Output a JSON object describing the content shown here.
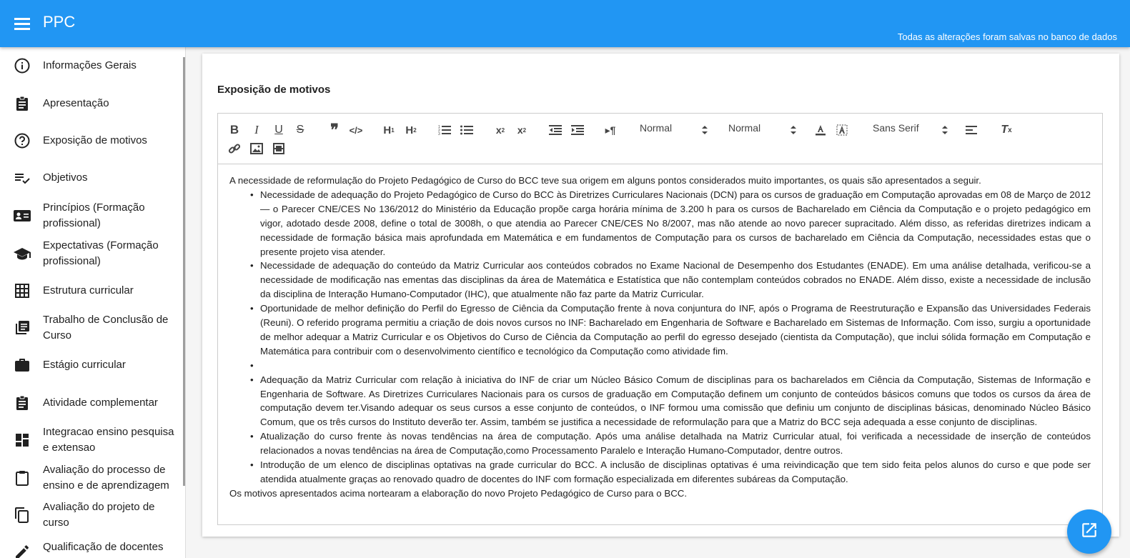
{
  "app": {
    "title": "PPC",
    "save_status": "Todas as alterações foram salvas no banco de dados"
  },
  "sidebar": {
    "items": [
      {
        "label": "Informações Gerais",
        "icon": "info-icon"
      },
      {
        "label": "Apresentação",
        "icon": "assignment-icon"
      },
      {
        "label": "Exposição de motivos",
        "icon": "help-icon"
      },
      {
        "label": "Objetivos",
        "icon": "playlist-check-icon"
      },
      {
        "label": "Princípios (Formação profissional)",
        "icon": "contact-card-icon"
      },
      {
        "label": "Expectativas (Formação profissional)",
        "icon": "school-icon"
      },
      {
        "label": "Estrutura curricular",
        "icon": "grid-icon"
      },
      {
        "label": "Trabalho de Conclusão de Curso",
        "icon": "library-books-icon"
      },
      {
        "label": "Estágio curricular",
        "icon": "work-icon"
      },
      {
        "label": "Atividade complementar",
        "icon": "assignment-icon"
      },
      {
        "label": "Integracao ensino pesquisa e extensao",
        "icon": "dashboard-icon"
      },
      {
        "label": "Avaliação do processo de ensino e de aprendizagem",
        "icon": "clipboard-icon"
      },
      {
        "label": "Avaliação do projeto de curso",
        "icon": "copy-icon"
      },
      {
        "label": "Qualificação de docentes",
        "icon": "edit-icon"
      }
    ]
  },
  "section": {
    "heading": "Exposição de motivos"
  },
  "toolbar": {
    "header_picker": "Normal",
    "size_picker": "Normal",
    "font_picker": "Sans Serif"
  },
  "editor": {
    "intro": "A necessidade de reformulação do Projeto Pedagógico de Curso do BCC teve sua origem em alguns pontos considerados muito importantes, os quais são apresentados a seguir.",
    "bullets": [
      "Necessidade de adequação do Projeto Pedagógico de Curso do BCC às Diretrizes Curriculares Nacionais (DCN) para os cursos de graduação em Computação aprovadas em 08 de Março de 2012 — o Parecer CNE/CES No 136/2012 do Ministério da Educação propõe carga horária mínima de 3.200 h para os cursos de Bacharelado em Ciência da Computação e o projeto pedagógico em vigor, adotado desde 2008, define o total de 3008h, o que atendia ao Parecer CNE/CES No 8/2007, mas não atende ao novo parecer supracitado. Além disso, as referidas diretrizes indicam a necessidade de formação básica mais aprofundada em Matemática e em fundamentos de Computação para os cursos de bacharelado em Ciência da Computação, necessidades estas que o presente projeto visa atender.",
      "Necessidade de adequação do conteúdo da Matriz Curricular aos conteúdos cobrados no Exame Nacional de Desempenho dos Estudantes (ENADE). Em uma análise detalhada, verificou-se a necessidade de modificação nas ementas das disciplinas da área de Matemática e Estatística que não contemplam conteúdos cobrados no ENADE. Além disso, existe a necessidade de inclusão da disciplina de Interação Humano-Computador (IHC), que atualmente não faz parte da Matriz Curricular.",
      "Oportunidade de melhor definição do Perfil do Egresso de Ciência da Computação frente à nova conjuntura do INF, após o Programa de Reestruturação e Expansão das Universidades Federais (Reuni). O referido programa permitiu a criação de dois novos cursos no INF: Bacharelado em Engenharia de Software e Bacharelado em Sistemas de Informação. Com isso, surgiu a oportunidade de melhor adequar a Matriz Curricular e os Objetivos do Curso de Ciência da Computação ao perfil do egresso desejado (cientista da Computação), que inclui sólida formação em Computação e Matemática para contribuir com o desenvolvimento científico e tecnológico da Computação como atividade fim.",
      "",
      "Adequação da Matriz Curricular com relação à iniciativa do INF de criar um Núcleo Básico Comum de disciplinas para os bacharelados em Ciência da Computação, Sistemas de Informação e Engenharia de Software. As Diretrizes Curriculares Nacionais para os cursos de graduação em Computação definem um conjunto de conteúdos básicos comuns que todos os cursos da área de computação devem ter.Visando adequar os seus cursos a esse conjunto de conteúdos, o INF formou uma comissão que definiu um conjunto de disciplinas básicas, denominado Núcleo Básico Comum, que os três cursos do Instituto deverão ter. Assim, também se justifica a necessidade de reformulação para que a Matriz do BCC seja adequada a esse conjunto de disciplinas.",
      "Atualização do curso frente às novas tendências na área de computação. Após uma análise detalhada na Matriz Curricular atual, foi verificada a necessidade de inserção de conteúdos relacionados a novas tendências na área de Computação,como Processamento Paralelo e Interação Humano-Computador, dentre outros.",
      "Introdução de um elenco de disciplinas optativas na grade curricular do BCC. A inclusão de disciplinas optativas é uma reivindicação que tem sido feita pelos alunos do curso e que pode ser atendida atualmente graças ao renovado quadro de docentes do INF com formação especializada em diferentes subáreas da Computação."
    ],
    "outro": "Os motivos apresentados acima nortearam a elaboração do novo Projeto Pedagógico de Curso para o BCC."
  },
  "colors": {
    "primary": "#2196f3",
    "sidebar_icon": "#212121"
  }
}
